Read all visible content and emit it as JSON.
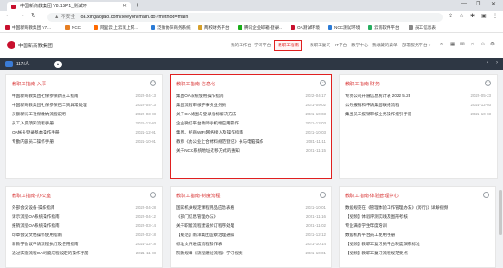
{
  "browser": {
    "tab_title": "中国新商教集团 V8.1SP1_测试环",
    "url_security": "▲ 不安全",
    "url": "oa.xingaojiao.com/seeyon/main.do?method=main",
    "bookmarks": [
      {
        "label": "中国新商教集团 V7...",
        "color": "#c8102e"
      },
      {
        "label": "NCC",
        "color": "#e67e22"
      },
      {
        "label": "阿里云-上云就上阿...",
        "color": "#ff6a00"
      },
      {
        "label": "泛微协同商务系统",
        "color": "#2b7bd6"
      },
      {
        "label": "两校财务平台",
        "color": "#d6a02b"
      },
      {
        "label": "腾讯企业邮箱-登录...",
        "color": "#1aad19"
      },
      {
        "label": "OA测试环境",
        "color": "#c8102e"
      },
      {
        "label": "NCC测试环境",
        "color": "#2b7bd6"
      },
      {
        "label": "云南软件平台",
        "color": "#27ae60"
      },
      {
        "label": "员工信息表",
        "color": "#888888"
      }
    ]
  },
  "header": {
    "brand": "中国新商教集团",
    "menu": [
      "我的工作台",
      "学习平台",
      "教职工指南",
      "教职工复习",
      "IT平台",
      "教学中心",
      "我收藏的菜单",
      "部署服务平台 ▾"
    ],
    "online": "1174人"
  },
  "cards": [
    {
      "title": "教职工指南-入事",
      "items": [
        {
          "text": "中国新商教集团社保参保新员工指南",
          "date": "2022-04-13"
        },
        {
          "text": "中国新商教集团社保参保已工资异常处理",
          "date": "2022-04-13"
        },
        {
          "text": "员额新员工社保缴纳流程说明",
          "date": "2022-03-08"
        },
        {
          "text": "员工入职须知流程手册",
          "date": "2021-12-03"
        },
        {
          "text": "OA帐号登录基本操作手册",
          "date": "2021-12-01"
        },
        {
          "text": "专勤内容员工操作手册",
          "date": "2021-10-01"
        }
      ]
    },
    {
      "title": "教职工指南-信息化",
      "items": [
        {
          "text": "集团OA系统使用操作指南",
          "date": "2022-04-17"
        },
        {
          "text": "集团流程审核子事务业务员",
          "date": "2021-09-02"
        },
        {
          "text": "关于OA试图与登录指标解决方法",
          "date": "2021-10-03"
        },
        {
          "text": "企业微信平台教师手机端应用操作",
          "date": "2021-12-03"
        },
        {
          "text": "集团、招商WIFI网络接入及操作指南",
          "date": "2021-10-03"
        },
        {
          "text": "教师《办公业上合材料规范登记》长与电脑操作",
          "date": "2021-11-11"
        },
        {
          "text": "关于NCC系统地址迁移方式的通知",
          "date": "2021-11-15"
        }
      ]
    },
    {
      "title": "教职工指南-财务",
      "items": [
        {
          "text": "专项公司开展信息统计表 2022 5.23",
          "date": "2022-05-23"
        },
        {
          "text": "公务报销和申请集团联络流程",
          "date": "2021-12-03"
        },
        {
          "text": "集团员工报销审核业务操作指引手册",
          "date": "2021-10-03"
        }
      ]
    },
    {
      "title": "教职工指南-办公室",
      "items": [
        {
          "text": "外部会议设备·操作指南",
          "date": "2022-04-28"
        },
        {
          "text": "请示流程OA系统操作指南",
          "date": "2022-04-12"
        },
        {
          "text": "报销流程OA系统操作指南",
          "date": "2022-03-14"
        },
        {
          "text": "印章会议文档操作使用指南",
          "date": "2022-02-18"
        },
        {
          "text": "新教学会议申请流程执行及使用指南",
          "date": "2021-12-18"
        },
        {
          "text": "通过实施流程OA制度成程设定的操作手册",
          "date": "2021-11-08"
        }
      ]
    },
    {
      "title": "教职工指南-制度流程",
      "items": [
        {
          "text": "国家机关规定课程用品应急表格",
          "date": "2021-10-01"
        },
        {
          "text": "《部门信息管理办法》",
          "date": "2021-11-16"
        },
        {
          "text": "关于职能流程建设修订程序处理",
          "date": "2021-11-02"
        },
        {
          "text": "【规范】南洋集团监察治理通知",
          "date": "2021-12-12"
        },
        {
          "text": "标准文件进度流程操作表",
          "date": "2021-10-14"
        },
        {
          "text": "院教规章《流程建设流程》学习视频",
          "date": "2021-10-01"
        }
      ]
    },
    {
      "title": "教职工指南-体验管理中心",
      "items": [
        {
          "text": "数据规范在《管理体验工作管理办法》(试行)》详解视频",
          "date": ""
        },
        {
          "text": "【视频】体验评测实践及图形考核",
          "date": ""
        },
        {
          "text": "专业满意学生年度培训",
          "date": ""
        },
        {
          "text": "数据机构平台员工使用手册",
          "date": ""
        },
        {
          "text": "【视频】教职工复习员平台制度演练标准",
          "date": ""
        },
        {
          "text": "【视频】教职工复习流程规范要点",
          "date": ""
        }
      ]
    }
  ]
}
